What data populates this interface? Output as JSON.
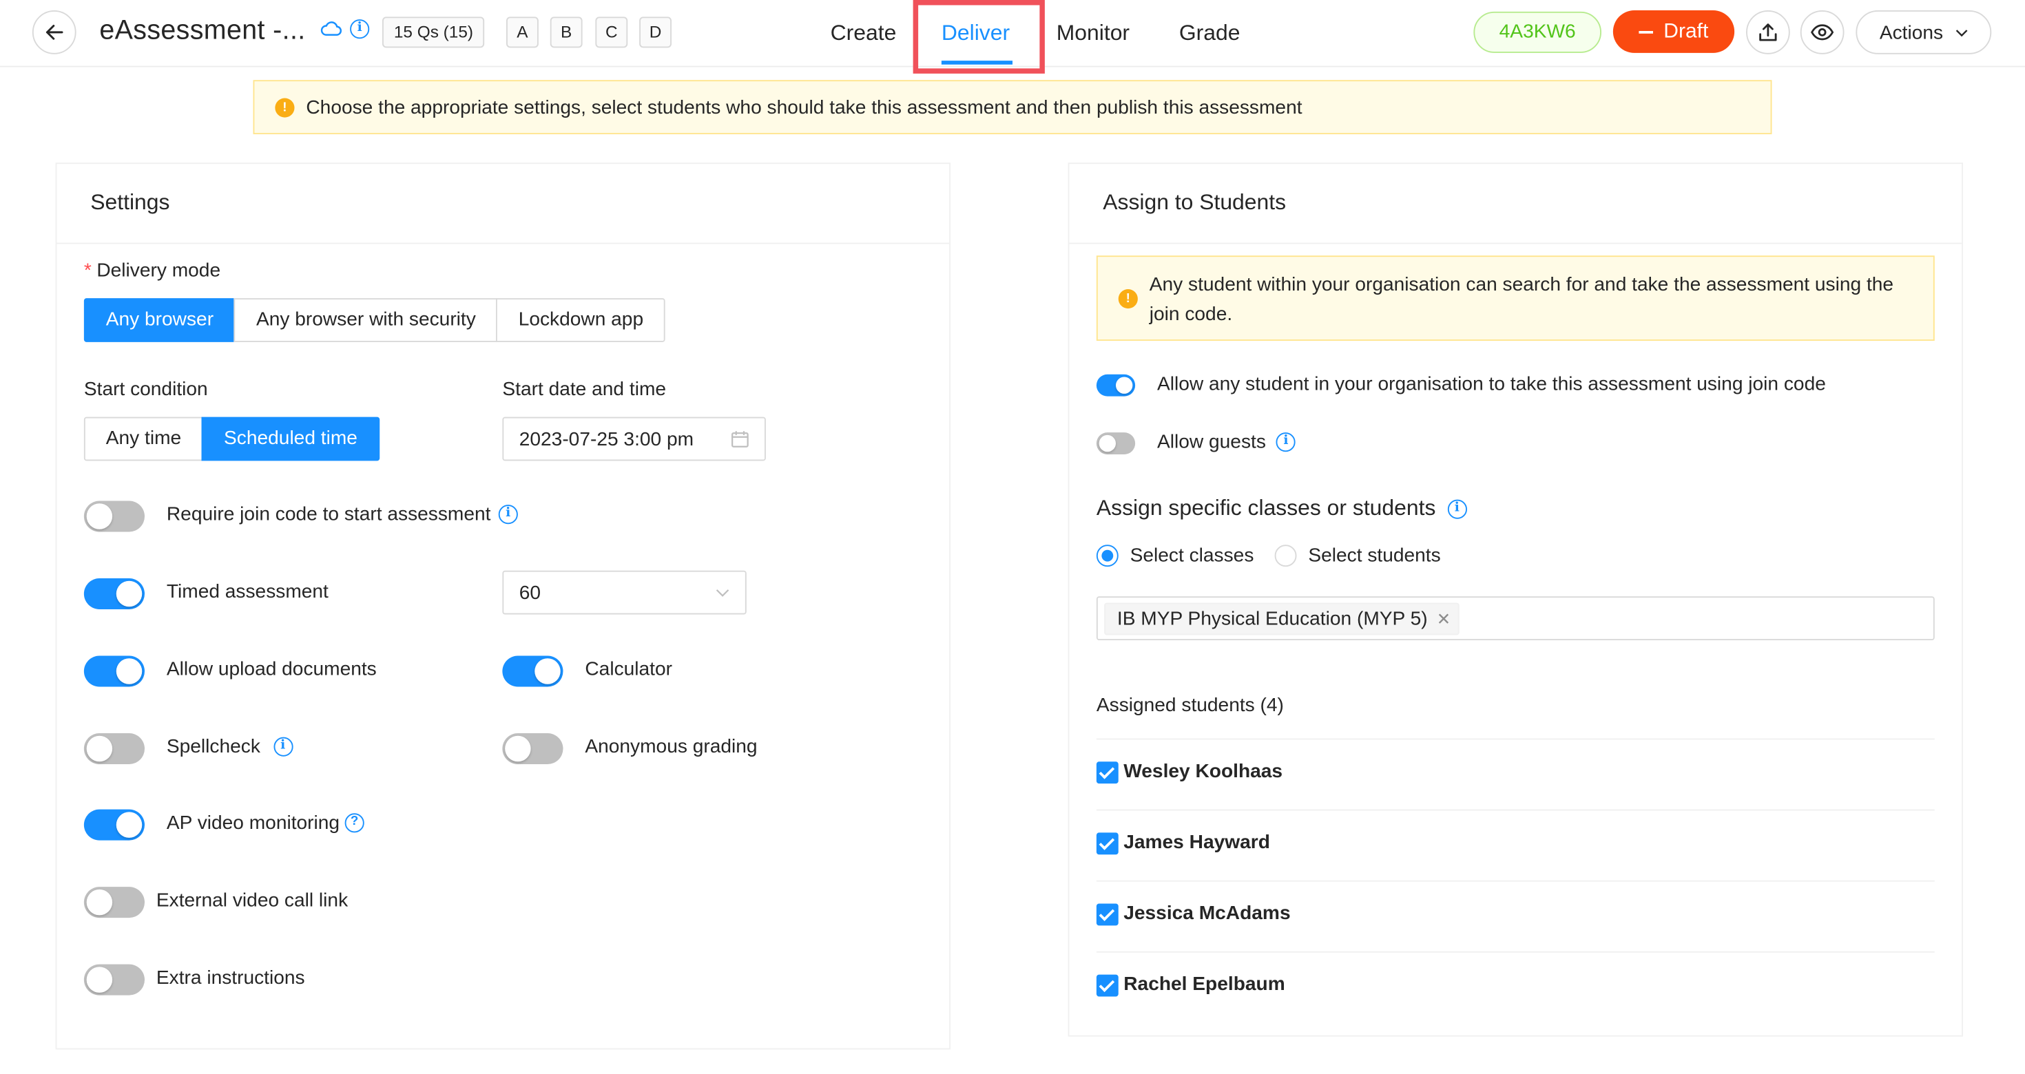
{
  "header": {
    "title": "eAssessment -...",
    "qs_badge": "15 Qs (15)",
    "versions": [
      "A",
      "B",
      "C",
      "D"
    ],
    "tabs": [
      {
        "label": "Create",
        "active": false
      },
      {
        "label": "Deliver",
        "active": true
      },
      {
        "label": "Monitor",
        "active": false
      },
      {
        "label": "Grade",
        "active": false
      }
    ],
    "join_code": "4A3KW6",
    "draft_label": "Draft",
    "actions_label": "Actions"
  },
  "banner": {
    "text": "Choose the appropriate settings, select students who should take this assessment and then publish this assessment"
  },
  "settings": {
    "title": "Settings",
    "delivery_mode_label": "Delivery mode",
    "delivery_modes": [
      "Any browser",
      "Any browser with security",
      "Lockdown app"
    ],
    "delivery_mode_selected": "Any browser",
    "start_condition_label": "Start condition",
    "start_conditions": [
      "Any time",
      "Scheduled time"
    ],
    "start_condition_selected": "Scheduled time",
    "start_datetime_label": "Start date and time",
    "start_datetime_value": "2023-07-25 3:00 pm",
    "require_join_code_label": "Require join code to start assessment",
    "require_join_code": false,
    "timed_assessment_label": "Timed assessment",
    "timed_assessment": true,
    "time_limit_value": "60",
    "allow_upload_label": "Allow upload documents",
    "allow_upload": true,
    "calculator_label": "Calculator",
    "calculator": true,
    "spellcheck_label": "Spellcheck",
    "spellcheck": false,
    "anonymous_grading_label": "Anonymous grading",
    "anonymous_grading": false,
    "ap_video_label": "AP video monitoring",
    "ap_video": true,
    "external_video_label": "External video call link",
    "external_video": false,
    "extra_instructions_label": "Extra instructions",
    "extra_instructions": false
  },
  "assign": {
    "title": "Assign to Students",
    "notice_text": "Any student within your organisation can search for and take the assessment using the join code.",
    "allow_any_label": "Allow any student in your organisation to take this assessment using join code",
    "allow_any": true,
    "allow_guests_label": "Allow guests",
    "allow_guests": false,
    "specific_heading": "Assign specific classes or students",
    "radio_classes": "Select classes",
    "radio_students": "Select students",
    "radio_selected": "Select classes",
    "selected_class_tag": "IB MYP Physical Education (MYP 5)",
    "assigned_heading": "Assigned students (4)",
    "students": [
      {
        "name": "Wesley Koolhaas",
        "checked": true
      },
      {
        "name": "James Hayward",
        "checked": true
      },
      {
        "name": "Jessica McAdams",
        "checked": true
      },
      {
        "name": "Rachel Epelbaum",
        "checked": true
      }
    ]
  },
  "colors": {
    "accent": "#1890ff",
    "draft": "#fa4a10",
    "join_code_text": "#52c41a",
    "highlight_box": "#f0515a",
    "warning": "#faad14"
  }
}
